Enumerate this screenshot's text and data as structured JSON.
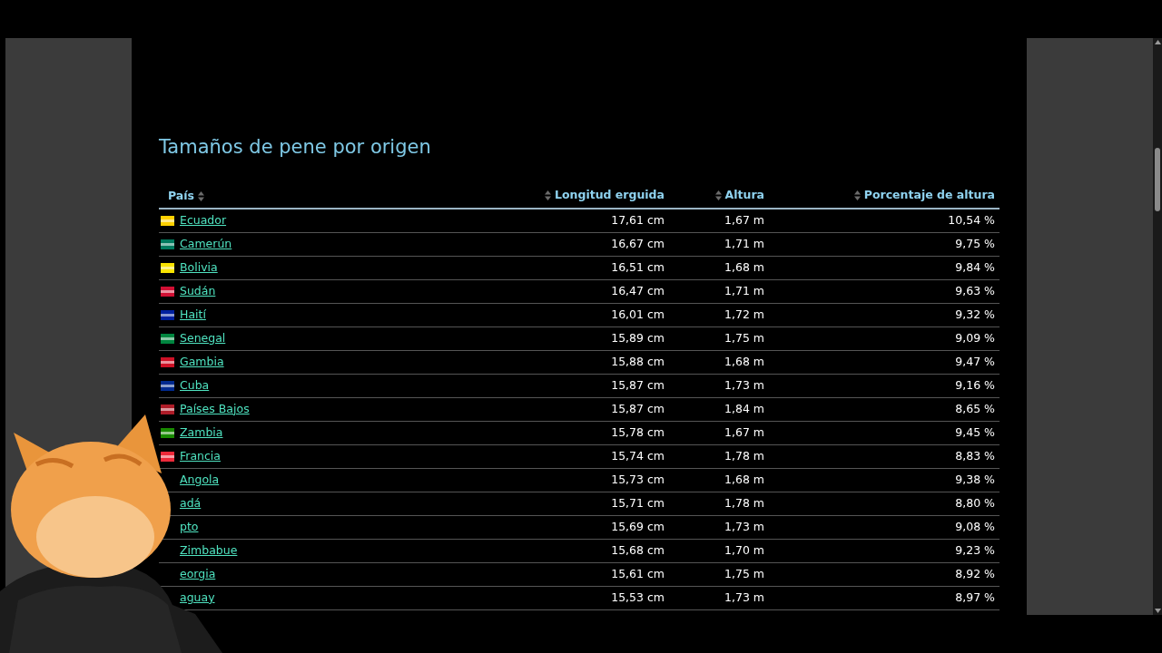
{
  "title": "Tamaños de pene por origen",
  "table": {
    "columns": [
      "País",
      "Longitud erguida",
      "Altura",
      "Porcentaje de altura"
    ],
    "rows": [
      {
        "country": "Ecuador",
        "flag": true,
        "color": "#ffd100",
        "length": "17,61 cm",
        "height": "1,67 m",
        "percent": "10,54 %"
      },
      {
        "country": "Camerún",
        "flag": true,
        "color": "#007a5e",
        "length": "16,67 cm",
        "height": "1,71 m",
        "percent": "9,75 %"
      },
      {
        "country": "Bolivia",
        "flag": true,
        "color": "#f9e300",
        "length": "16,51 cm",
        "height": "1,68 m",
        "percent": "9,84 %"
      },
      {
        "country": "Sudán",
        "flag": true,
        "color": "#d21034",
        "length": "16,47 cm",
        "height": "1,71 m",
        "percent": "9,63 %"
      },
      {
        "country": "Haití",
        "flag": true,
        "color": "#00209f",
        "length": "16,01 cm",
        "height": "1,72 m",
        "percent": "9,32 %"
      },
      {
        "country": "Senegal",
        "flag": true,
        "color": "#00853f",
        "length": "15,89 cm",
        "height": "1,75 m",
        "percent": "9,09 %"
      },
      {
        "country": "Gambia",
        "flag": true,
        "color": "#ce1126",
        "length": "15,88 cm",
        "height": "1,68 m",
        "percent": "9,47 %"
      },
      {
        "country": "Cuba",
        "flag": true,
        "color": "#002a8f",
        "length": "15,87 cm",
        "height": "1,73 m",
        "percent": "9,16 %"
      },
      {
        "country": "Países Bajos",
        "flag": true,
        "color": "#ae1c28",
        "length": "15,87 cm",
        "height": "1,84 m",
        "percent": "8,65 %"
      },
      {
        "country": "Zambia",
        "flag": true,
        "color": "#198a00",
        "length": "15,78 cm",
        "height": "1,67 m",
        "percent": "9,45 %"
      },
      {
        "country": "Francia",
        "flag": true,
        "color": "#ed2939",
        "length": "15,74 cm",
        "height": "1,78 m",
        "percent": "8,83 %"
      },
      {
        "country": "Angola",
        "flag": false,
        "length": "15,73 cm",
        "height": "1,68 m",
        "percent": "9,38 %"
      },
      {
        "country": "adá",
        "flag": false,
        "length": "15,71 cm",
        "height": "1,78 m",
        "percent": "8,80 %"
      },
      {
        "country": "pto",
        "flag": false,
        "length": "15,69 cm",
        "height": "1,73 m",
        "percent": "9,08 %"
      },
      {
        "country": "Zimbabue",
        "flag": false,
        "length": "15,68 cm",
        "height": "1,70 m",
        "percent": "9,23 %"
      },
      {
        "country": "eorgia",
        "flag": false,
        "length": "15,61 cm",
        "height": "1,75 m",
        "percent": "8,92 %"
      },
      {
        "country": "aguay",
        "flag": false,
        "length": "15,53 cm",
        "height": "1,73 m",
        "percent": "8,97 %"
      }
    ]
  }
}
